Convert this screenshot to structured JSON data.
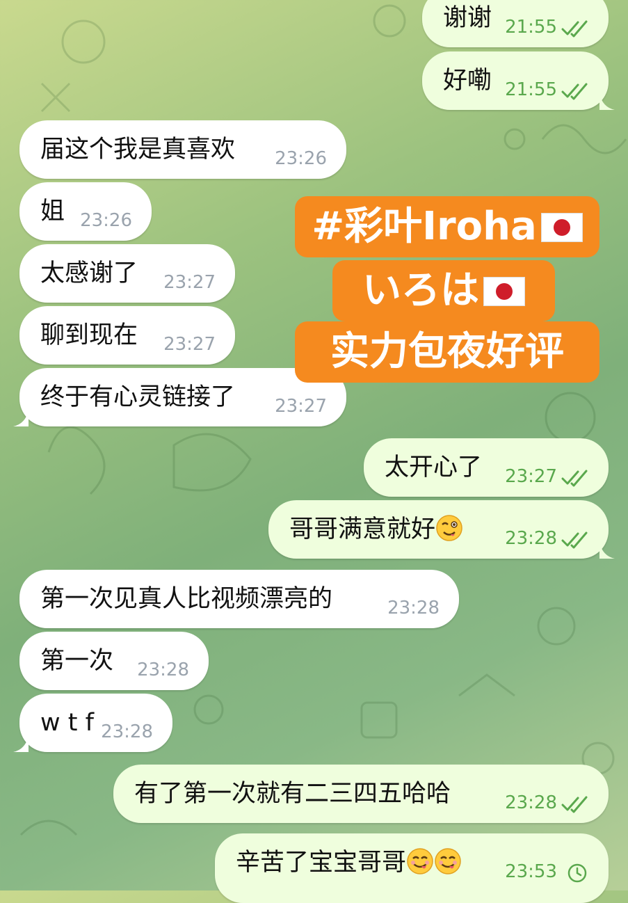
{
  "messages": [
    {
      "id": "m1",
      "dir": "out",
      "text": "谢谢",
      "time": "21:55",
      "status": "read"
    },
    {
      "id": "m2",
      "dir": "out",
      "text": "好嘞",
      "time": "21:55",
      "status": "read"
    },
    {
      "id": "m3",
      "dir": "in",
      "text": "届这个我是真喜欢",
      "time": "23:26"
    },
    {
      "id": "m4",
      "dir": "in",
      "text": "姐",
      "time": "23:26"
    },
    {
      "id": "m5",
      "dir": "in",
      "text": "太感谢了",
      "time": "23:27"
    },
    {
      "id": "m6",
      "dir": "in",
      "text": "聊到现在",
      "time": "23:27"
    },
    {
      "id": "m7",
      "dir": "in",
      "text": "终于有心灵链接了",
      "time": "23:27"
    },
    {
      "id": "m8",
      "dir": "out",
      "text": "太开心了",
      "time": "23:27",
      "status": "read"
    },
    {
      "id": "m9",
      "dir": "out",
      "text": "哥哥满意就好",
      "time": "23:28",
      "status": "read",
      "emoji": [
        "winking-face"
      ]
    },
    {
      "id": "m10",
      "dir": "in",
      "text": "第一次见真人比视频漂亮的",
      "time": "23:28"
    },
    {
      "id": "m11",
      "dir": "in",
      "text": "第一次",
      "time": "23:28"
    },
    {
      "id": "m12",
      "dir": "in",
      "text": "w t f",
      "time": "23:28"
    },
    {
      "id": "m13",
      "dir": "out",
      "text": "有了第一次就有二三四五哈哈",
      "time": "23:28",
      "status": "read"
    },
    {
      "id": "m14",
      "dir": "out",
      "text": "辛苦了宝宝哥哥",
      "time": "23:53",
      "status": "sending",
      "emoji": [
        "yum-face",
        "yum-face"
      ]
    }
  ],
  "promo": {
    "line1": "#彩叶Iroha",
    "line2": "いろは",
    "line3": "实力包夜好评",
    "bg_color": "#f58a1f",
    "flag_icon": "japan-flag-icon"
  },
  "colors": {
    "incoming_bubble": "#ffffff",
    "outgoing_bubble": "#effedd",
    "outgoing_time": "#5aa84d",
    "incoming_time": "#9aa3ad"
  }
}
